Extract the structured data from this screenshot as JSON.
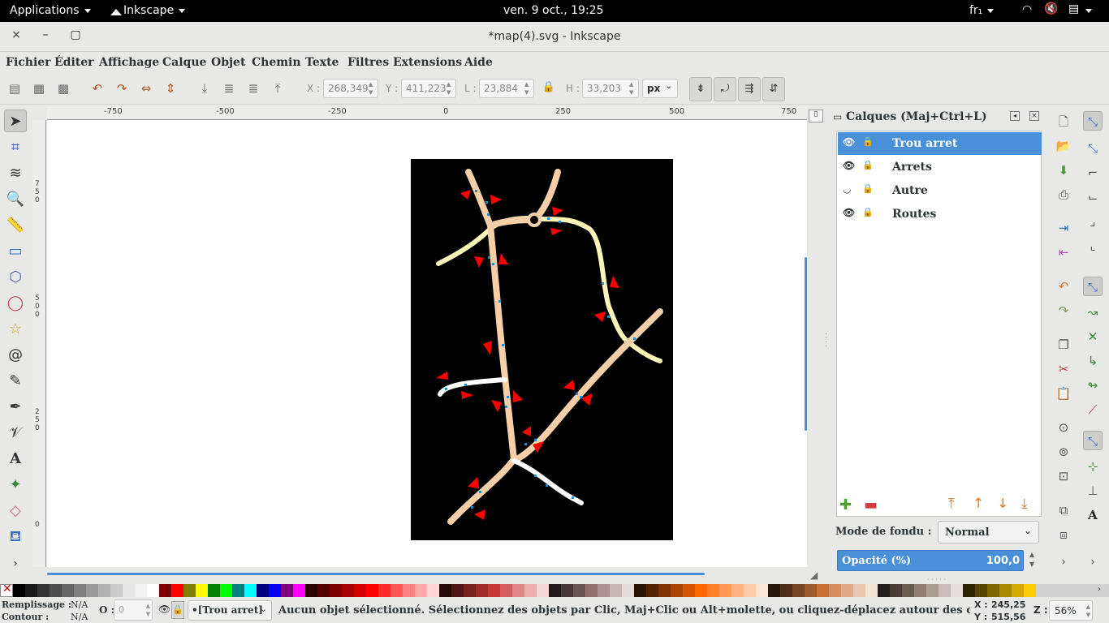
{
  "gnome": {
    "applications": "Applications",
    "app_name": "Inkscape",
    "clock": "ven.  9 oct., 19:25",
    "keyboard": "fr₁"
  },
  "window": {
    "title": "*map(4).svg - Inkscape",
    "close": "×",
    "minimize": "–",
    "maximize": "▢"
  },
  "menu": [
    "Fichier",
    "Éditer",
    "Affichage",
    "Calque",
    "Objet",
    "Chemin",
    "Texte",
    "Filtres",
    "Extensions",
    "Aide"
  ],
  "controls": {
    "x_label": "X :",
    "x_value": "268,349",
    "y_label": "Y :",
    "y_value": "411,223",
    "w_label": "L :",
    "w_value": "23,884",
    "h_label": "H :",
    "h_value": "33,203",
    "unit": "px"
  },
  "ruler": {
    "h_ticks": [
      "-750",
      "-500",
      "-250",
      "0",
      "250",
      "500",
      "750"
    ],
    "v_ticks": [
      "7\n5\n0",
      "5\n0\n0",
      "2\n5\n0",
      "0"
    ]
  },
  "layers_panel": {
    "title": "Calques (Maj+Ctrl+L)",
    "layers": [
      {
        "name": "Trou arret",
        "selected": true
      },
      {
        "name": "Arrets",
        "selected": false
      },
      {
        "name": "Autre",
        "selected": false
      },
      {
        "name": "Routes",
        "selected": false
      }
    ],
    "blend_label": "Mode de fondu :",
    "blend_value": "Normal",
    "opacity_label": "Opacité (%)",
    "opacity_value": "100,0"
  },
  "palette": [
    "#000000",
    "#1a1a1a",
    "#333333",
    "#4d4d4d",
    "#666666",
    "#808080",
    "#999999",
    "#b3b3b3",
    "#cccccc",
    "#e6e6e6",
    "#f2f2f2",
    "#ffffff",
    "#800000",
    "#ff0000",
    "#808000",
    "#ffff00",
    "#008000",
    "#00ff00",
    "#008080",
    "#00ffff",
    "#000080",
    "#0000ff",
    "#800080",
    "#ff00ff",
    "#2b0000",
    "#550000",
    "#800000",
    "#aa0000",
    "#d40000",
    "#ff0000",
    "#ff2a2a",
    "#ff5555",
    "#ff8080",
    "#ffaaaa",
    "#ffd5d5",
    "#280b0b",
    "#501616",
    "#782121",
    "#a02c2c",
    "#c83737",
    "#d35f5f",
    "#de8787",
    "#e9afaf",
    "#f4d7d7",
    "#241c1c",
    "#483737",
    "#6c5353",
    "#916f6f",
    "#ac9393",
    "#c8b7b7",
    "#e3dbdb",
    "#2b1100",
    "#552200",
    "#803300",
    "#aa4400",
    "#d45500",
    "#ff6600",
    "#ff7f2a",
    "#ff9955",
    "#ffb380",
    "#ffccaa",
    "#ffe6d5",
    "#28170b",
    "#502d16",
    "#784421",
    "#a05a2c",
    "#c87137",
    "#d38d5f",
    "#deaa87",
    "#e9c6af",
    "#f4e3d7",
    "#241f1c",
    "#483e37",
    "#6c5d53",
    "#917c6f",
    "#ac9d93",
    "#c8beb7",
    "#e3dedb",
    "#2b2200",
    "#554400",
    "#806600",
    "#aa8800",
    "#d4aa00",
    "#ffcc00"
  ],
  "status": {
    "fill_label": "Remplissage :",
    "fill_value": "N/A",
    "stroke_label": "Contour :",
    "stroke_value": "N/A",
    "opacity_label": "O :",
    "opacity_value": "0",
    "layer_value": "•[Trou arret]",
    "message": "Aucun objet sélectionné. Sélectionnez des objets par Clic, Maj+Clic ou Alt+molette, ou cliquez-déplacez autour des objets à sé",
    "x_label": "X :",
    "x_value": "245,25",
    "y_label": "Y :",
    "y_value": "515,56",
    "z_label": "Z :",
    "zoom_value": "56%"
  },
  "colors": {
    "selection": "#4a90d9",
    "road_main": "#f6cfa8",
    "road_yellow": "#f9f5b8",
    "stop_marker": "#ff0000",
    "stop_dot": "#1a90d0"
  }
}
